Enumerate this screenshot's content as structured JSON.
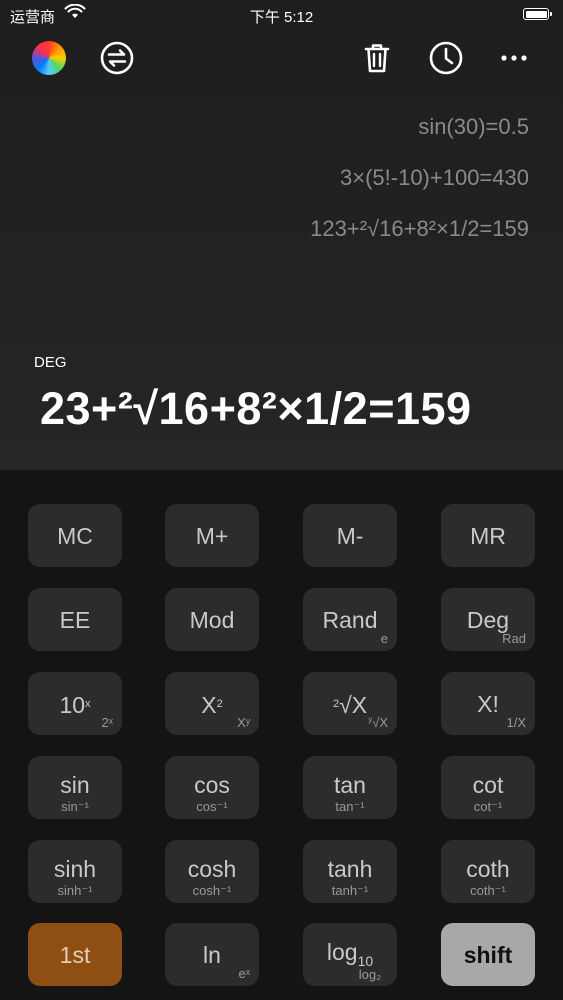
{
  "status_bar": {
    "carrier": "运营商",
    "time": "下午 5:12"
  },
  "toolbar": {
    "icons": [
      "color-wheel-icon",
      "swap-icon",
      "trash-icon",
      "history-icon",
      "more-icon"
    ]
  },
  "history": [
    "sin(30)=0.5",
    "3×(5!-10)+100=430",
    "123+²√16+8²×1/2=159"
  ],
  "display": {
    "mode": "DEG",
    "expression": "23+²√16+8²×1/2=159"
  },
  "keys": {
    "mc": "MC",
    "mplus": "M+",
    "mminus": "M-",
    "mr": "MR",
    "ee": "EE",
    "mod": "Mod",
    "rand": "Rand",
    "rand_sub": "e",
    "deg": "Deg",
    "deg_sub": "Rad",
    "pow10_base": "10",
    "pow10_exp": "x",
    "pow10_sub": "2ˣ",
    "square_base": "X",
    "square_exp": "2",
    "square_sub": "Xʸ",
    "root_index": "2",
    "root_label": "√X",
    "root_sub_index": "y",
    "root_sub": "√X",
    "fact": "X!",
    "fact_sub": "1/X",
    "sin": "sin",
    "sin_sub": "sin⁻¹",
    "cos": "cos",
    "cos_sub": "cos⁻¹",
    "tan": "tan",
    "tan_sub": "tan⁻¹",
    "cot": "cot",
    "cot_sub": "cot⁻¹",
    "sinh": "sinh",
    "sinh_sub": "sinh⁻¹",
    "cosh": "cosh",
    "cosh_sub": "cosh⁻¹",
    "tanh": "tanh",
    "tanh_sub": "tanh⁻¹",
    "coth": "coth",
    "coth_sub": "coth⁻¹",
    "first": "1st",
    "ln": "ln",
    "ln_sub": "eˣ",
    "log_base": "log",
    "log_idx": "10",
    "log_sub": "log₂",
    "shift": "shift"
  },
  "colors": {
    "background": "#141414",
    "key": "#2c2c2c",
    "accent_orange": "#8f4e12",
    "shift_key": "#a8a8a8"
  }
}
